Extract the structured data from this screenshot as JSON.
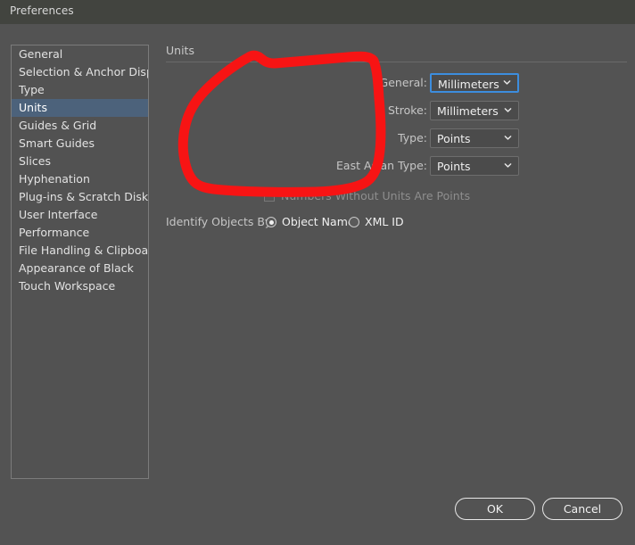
{
  "window": {
    "title": "Preferences"
  },
  "sidebar": {
    "items": [
      {
        "label": "General",
        "selected": false
      },
      {
        "label": "Selection & Anchor Display",
        "selected": false
      },
      {
        "label": "Type",
        "selected": false
      },
      {
        "label": "Units",
        "selected": true
      },
      {
        "label": "Guides & Grid",
        "selected": false
      },
      {
        "label": "Smart Guides",
        "selected": false
      },
      {
        "label": "Slices",
        "selected": false
      },
      {
        "label": "Hyphenation",
        "selected": false
      },
      {
        "label": "Plug-ins & Scratch Disks",
        "selected": false
      },
      {
        "label": "User Interface",
        "selected": false
      },
      {
        "label": "Performance",
        "selected": false
      },
      {
        "label": "File Handling & Clipboard",
        "selected": false
      },
      {
        "label": "Appearance of Black",
        "selected": false
      },
      {
        "label": "Touch Workspace",
        "selected": false
      }
    ]
  },
  "main": {
    "section_title": "Units",
    "fields": [
      {
        "label": "General:",
        "value": "Millimeters",
        "focused": true
      },
      {
        "label": "Stroke:",
        "value": "Millimeters",
        "focused": false
      },
      {
        "label": "Type:",
        "value": "Points",
        "focused": false
      },
      {
        "label": "East Asian Type:",
        "value": "Points",
        "focused": false
      }
    ],
    "checkbox": {
      "label": "Numbers Without Units Are Points",
      "checked": false,
      "disabled": true
    },
    "identify": {
      "label": "Identify Objects By:",
      "options": [
        {
          "label": "Object Name",
          "selected": true
        },
        {
          "label": "XML ID",
          "selected": false
        }
      ]
    }
  },
  "footer": {
    "ok_label": "OK",
    "cancel_label": "Cancel"
  },
  "annotation": {
    "shape": "hand-drawn-red-circle",
    "color": "#f71414"
  },
  "colors": {
    "titlebar_bg": "#42443f",
    "window_bg": "#535353",
    "selection_blue": "#4c627b",
    "focus_blue": "#3c8dde",
    "annotation_red": "#f71414"
  }
}
